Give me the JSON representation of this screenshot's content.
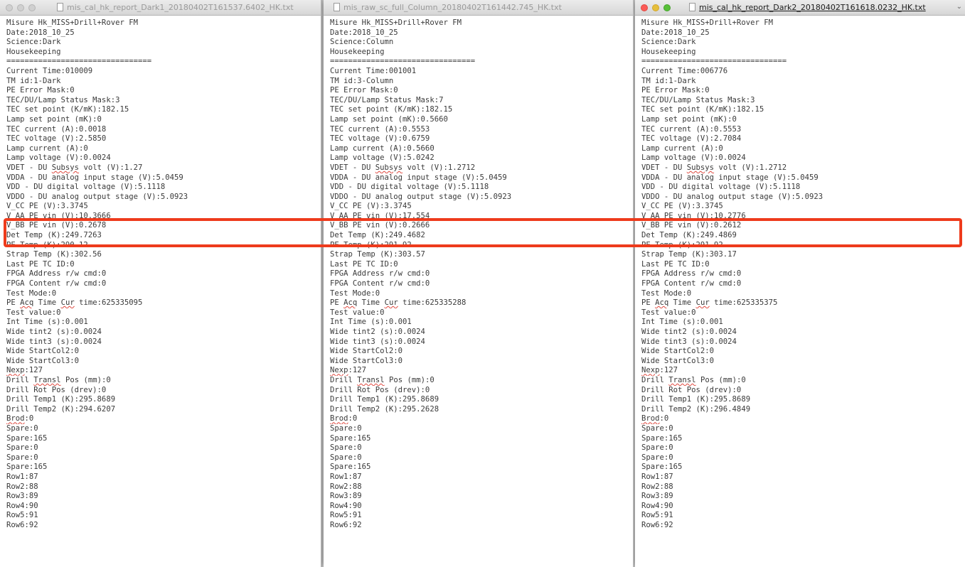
{
  "windows": [
    {
      "title": "mis_cal_hk_report_Dark1_20180402T161537.6402_HK.txt",
      "active": false,
      "lines": [
        "Misure Hk_MISS+Drill+Rover FM",
        "Date:2018_10_25",
        "Science:Dark",
        "Housekeeping",
        "================================",
        "Current Time:010009",
        "TM id:1-Dark",
        "PE Error Mask:0",
        "TEC/DU/Lamp Status Mask:3",
        "TEC set point (K/mK):182.15",
        "Lamp set point (mK):0",
        "TEC current (A):0.0018",
        "TEC voltage (V):2.5850",
        "Lamp current (A):0",
        "Lamp voltage (V):0.0024",
        "VDET - DU Subsys volt (V):1.27",
        "VDDA - DU analog input stage (V):5.0459",
        "VDD - DU digital voltage (V):5.1118",
        "VDDO - DU analog output stage (V):5.0923",
        "V_CC PE (V):3.3745",
        "V_AA PE vin (V):10.3666",
        "V_BB PE vin (V):0.2678",
        "Det Temp (K):249.7263",
        "PE Temp (K):290.12",
        "Strap Temp (K):302.56",
        "Last PE TC ID:0",
        "FPGA Address r/w cmd:0",
        "FPGA Content r/w cmd:0",
        "Test Mode:0",
        "PE Acq Time Cur time:625335095",
        "Test value:0",
        "Int Time (s):0.001",
        "Wide tint2 (s):0.0024",
        "Wide tint3 (s):0.0024",
        "Wide StartCol2:0",
        "Wide StartCol3:0",
        "Nexp:127",
        "Drill Transl Pos (mm):0",
        "Drill Rot Pos (drev):0",
        "Drill Temp1 (K):295.8689",
        "Drill Temp2 (K):294.6207",
        "Brod:0",
        "Spare:0",
        "Spare:165",
        "Spare:0",
        "Spare:0",
        "Spare:165",
        "Row1:87",
        "Row2:88",
        "Row3:89",
        "Row4:90",
        "Row5:91",
        "Row6:92"
      ]
    },
    {
      "title": "mis_raw_sc_full_Column_20180402T161442.745_HK.txt",
      "active": false,
      "lines": [
        "Misure Hk_MISS+Drill+Rover FM",
        "Date:2018_10_25",
        "Science:Column",
        "Housekeeping",
        "================================",
        "Current Time:001001",
        "TM id:3-Column",
        "PE Error Mask:0",
        "TEC/DU/Lamp Status Mask:7",
        "TEC set point (K/mK):182.15",
        "Lamp set point (mK):0.5660",
        "TEC current (A):0.5553",
        "TEC voltage (V):0.6759",
        "Lamp current (A):0.5660",
        "Lamp voltage (V):5.0242",
        "VDET - DU Subsys volt (V):1.2712",
        "VDDA - DU analog input stage (V):5.0459",
        "VDD - DU digital voltage (V):5.1118",
        "VDDO - DU analog output stage (V):5.0923",
        "V_CC PE (V):3.3745",
        "V_AA PE vin (V):17.554",
        "V_BB PE vin (V):0.2666",
        "Det Temp (K):249.4682",
        "PE Temp (K):291.92",
        "Strap Temp (K):303.57",
        "Last PE TC ID:0",
        "FPGA Address r/w cmd:0",
        "FPGA Content r/w cmd:0",
        "Test Mode:0",
        "PE Acq Time Cur time:625335288",
        "Test value:0",
        "Int Time (s):0.001",
        "Wide tint2 (s):0.0024",
        "Wide tint3 (s):0.0024",
        "Wide StartCol2:0",
        "Wide StartCol3:0",
        "Nexp:127",
        "Drill Transl Pos (mm):0",
        "Drill Rot Pos (drev):0",
        "Drill Temp1 (K):295.8689",
        "Drill Temp2 (K):295.2628",
        "Brod:0",
        "Spare:0",
        "Spare:165",
        "Spare:0",
        "Spare:0",
        "Spare:165",
        "Row1:87",
        "Row2:88",
        "Row3:89",
        "Row4:90",
        "Row5:91",
        "Row6:92"
      ]
    },
    {
      "title": "mis_cal_hk_report_Dark2_20180402T161618.0232_HK.txt",
      "active": true,
      "lines": [
        "Misure Hk_MISS+Drill+Rover FM",
        "Date:2018_10_25",
        "Science:Dark",
        "Housekeeping",
        "================================",
        "Current Time:006776",
        "TM id:1-Dark",
        "PE Error Mask:0",
        "TEC/DU/Lamp Status Mask:3",
        "TEC set point (K/mK):182.15",
        "Lamp set point (mK):0",
        "TEC current (A):0.5553",
        "TEC voltage (V):2.7084",
        "Lamp current (A):0",
        "Lamp voltage (V):0.0024",
        "VDET - DU Subsys volt (V):1.2712",
        "VDDA - DU analog input stage (V):5.0459",
        "VDD - DU digital voltage (V):5.1118",
        "VDDO - DU analog output stage (V):5.0923",
        "V_CC PE (V):3.3745",
        "V_AA PE vin (V):10.2776",
        "V_BB PE vin (V):0.2612",
        "Det Temp (K):249.4869",
        "PE Temp (K):291.92",
        "Strap Temp (K):303.17",
        "Last PE TC ID:0",
        "FPGA Address r/w cmd:0",
        "FPGA Content r/w cmd:0",
        "Test Mode:0",
        "PE Acq Time Cur time:625335375",
        "Test value:0",
        "Int Time (s):0.001",
        "Wide tint2 (s):0.0024",
        "Wide tint3 (s):0.0024",
        "Wide StartCol2:0",
        "Wide StartCol3:0",
        "Nexp:127",
        "Drill Transl Pos (mm):0",
        "Drill Rot Pos (drev):0",
        "Drill Temp1 (K):295.8689",
        "Drill Temp2 (K):296.4849",
        "Brod:0",
        "Spare:0",
        "Spare:165",
        "Spare:0",
        "Spare:0",
        "Spare:165",
        "Row1:87",
        "Row2:88",
        "Row3:89",
        "Row4:90",
        "Row5:91",
        "Row6:92"
      ]
    }
  ],
  "spellcheck_words": [
    "Subsys",
    "Acq",
    "Cur",
    "Nexp",
    "Transl",
    "Brod"
  ],
  "colors": {
    "highlight": "#ee3b1c",
    "text": "#3a3a3a",
    "spellcheck": "#e0463c"
  }
}
